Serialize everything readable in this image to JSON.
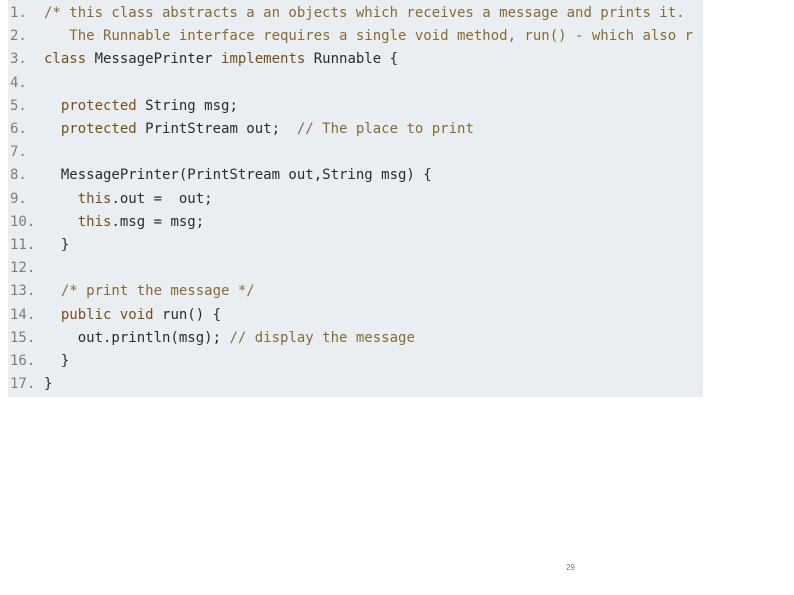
{
  "code": {
    "lines": [
      {
        "num": "1.",
        "tokens": [
          {
            "t": "/* this class abstracts a an objects which receives a message and prints it.",
            "c": "comment"
          }
        ]
      },
      {
        "num": "2.",
        "tokens": [
          {
            "t": "   The Runnable interface requires a single void method, run() - which also r",
            "c": "comment"
          }
        ]
      },
      {
        "num": "3.",
        "tokens": [
          {
            "t": "class ",
            "c": "kw"
          },
          {
            "t": "MessagePrinter ",
            "c": "type"
          },
          {
            "t": "implements ",
            "c": "kw"
          },
          {
            "t": "Runnable ",
            "c": "type"
          },
          {
            "t": "{",
            "c": "plain"
          }
        ]
      },
      {
        "num": "4.",
        "tokens": []
      },
      {
        "num": "5.",
        "tokens": [
          {
            "t": "  protected ",
            "c": "kw"
          },
          {
            "t": "String msg;",
            "c": "plain"
          }
        ]
      },
      {
        "num": "6.",
        "tokens": [
          {
            "t": "  protected ",
            "c": "kw"
          },
          {
            "t": "PrintStream out;  ",
            "c": "plain"
          },
          {
            "t": "// The place to print",
            "c": "comment"
          }
        ]
      },
      {
        "num": "7.",
        "tokens": []
      },
      {
        "num": "8.",
        "tokens": [
          {
            "t": "  MessagePrinter(PrintStream out,String msg) {",
            "c": "plain"
          }
        ]
      },
      {
        "num": "9.",
        "tokens": [
          {
            "t": "    this",
            "c": "kw"
          },
          {
            "t": ".out =  out;",
            "c": "plain"
          }
        ]
      },
      {
        "num": "10.",
        "tokens": [
          {
            "t": "    this",
            "c": "kw"
          },
          {
            "t": ".msg = msg;",
            "c": "plain"
          }
        ]
      },
      {
        "num": "11.",
        "tokens": [
          {
            "t": "  }",
            "c": "plain"
          }
        ]
      },
      {
        "num": "12.",
        "tokens": []
      },
      {
        "num": "13.",
        "tokens": [
          {
            "t": "  /* print the message */",
            "c": "comment"
          }
        ]
      },
      {
        "num": "14.",
        "tokens": [
          {
            "t": "  public void ",
            "c": "kw"
          },
          {
            "t": "run() {",
            "c": "plain"
          }
        ]
      },
      {
        "num": "15.",
        "tokens": [
          {
            "t": "    out.println(msg); ",
            "c": "plain"
          },
          {
            "t": "// display the message",
            "c": "comment"
          }
        ]
      },
      {
        "num": "16.",
        "tokens": [
          {
            "t": "  }",
            "c": "plain"
          }
        ]
      },
      {
        "num": "17.",
        "tokens": [
          {
            "t": "}",
            "c": "plain"
          }
        ]
      }
    ]
  },
  "footer": {
    "page_number": "29"
  }
}
